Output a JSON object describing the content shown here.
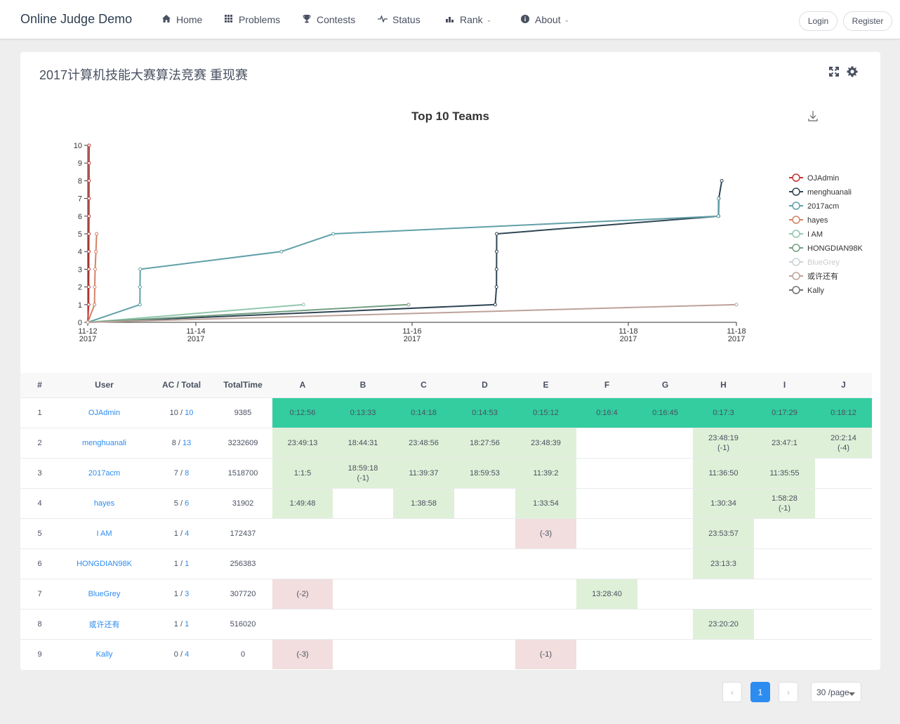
{
  "nav": {
    "brand": "Online Judge Demo",
    "items": [
      {
        "label": "Home",
        "icon": "home-icon"
      },
      {
        "label": "Problems",
        "icon": "grid-icon"
      },
      {
        "label": "Contests",
        "icon": "trophy-icon"
      },
      {
        "label": "Status",
        "icon": "pulse-icon"
      },
      {
        "label": "Rank",
        "icon": "bar-chart-icon"
      },
      {
        "label": "About",
        "icon": "info-icon"
      }
    ],
    "login": "Login",
    "register": "Register"
  },
  "contest": {
    "title": "2017计算机技能大赛算法竞赛 重现赛"
  },
  "chart_data": {
    "type": "line",
    "title": "Top 10 Teams",
    "xlabel": "",
    "ylabel": "",
    "ylim": [
      0,
      10
    ],
    "xlim": [
      "2017-11-12 00:00",
      "2017-11-18 00:00"
    ],
    "x_ticks": [
      {
        "t": "2017-11-12 00:00",
        "line1": "11-12",
        "line2": "2017"
      },
      {
        "t": "2017-11-13 00:00",
        "line1": "11-14",
        "line2": "2017"
      },
      {
        "t": "2017-11-15 00:00",
        "line1": "11-16",
        "line2": "2017"
      },
      {
        "t": "2017-11-17 00:00",
        "line1": "11-18",
        "line2": "2017"
      },
      {
        "t": "2017-11-18 00:00",
        "line1": "11-18",
        "line2": "2017"
      }
    ],
    "y_ticks": [
      0,
      1,
      2,
      3,
      4,
      5,
      6,
      7,
      8,
      9,
      10
    ],
    "grid": false,
    "legend": "right",
    "series": [
      {
        "name": "OJAdmin",
        "color": "#c23531",
        "points": [
          [
            "2017-11-12 00:00",
            0
          ],
          [
            "2017-11-12 00:12",
            1
          ],
          [
            "2017-11-12 00:13",
            2
          ],
          [
            "2017-11-12 00:14",
            3
          ],
          [
            "2017-11-12 00:14",
            4
          ],
          [
            "2017-11-12 00:15",
            5
          ],
          [
            "2017-11-12 00:16",
            6
          ],
          [
            "2017-11-12 00:16",
            7
          ],
          [
            "2017-11-12 00:17",
            8
          ],
          [
            "2017-11-12 00:17",
            9
          ],
          [
            "2017-11-12 00:18",
            10
          ]
        ]
      },
      {
        "name": "menghuanali",
        "color": "#2f4554",
        "points": [
          [
            "2017-11-12 00:00",
            0
          ],
          [
            "2017-11-15 18:27",
            1
          ],
          [
            "2017-11-15 18:44",
            2
          ],
          [
            "2017-11-15 18:45",
            3
          ],
          [
            "2017-11-15 18:46",
            4
          ],
          [
            "2017-11-15 18:47",
            5
          ],
          [
            "2017-11-17 20:02",
            6
          ],
          [
            "2017-11-17 20:05",
            7
          ],
          [
            "2017-11-17 20:45",
            8
          ]
        ]
      },
      {
        "name": "2017acm",
        "color": "#61a0a8",
        "points": [
          [
            "2017-11-12 00:00",
            0
          ],
          [
            "2017-11-12 11:35",
            1
          ],
          [
            "2017-11-12 11:36",
            2
          ],
          [
            "2017-11-12 11:39",
            3
          ],
          [
            "2017-11-13 18:59",
            4
          ],
          [
            "2017-11-14 06:30",
            5
          ],
          [
            "2017-11-17 19:59",
            6
          ],
          [
            "2017-11-17 20:01",
            7
          ]
        ]
      },
      {
        "name": "hayes",
        "color": "#d48265",
        "points": [
          [
            "2017-11-12 00:00",
            0
          ],
          [
            "2017-11-12 01:30",
            1
          ],
          [
            "2017-11-12 01:33",
            2
          ],
          [
            "2017-11-12 01:38",
            3
          ],
          [
            "2017-11-12 01:49",
            4
          ],
          [
            "2017-11-12 01:58",
            5
          ]
        ]
      },
      {
        "name": "I AM",
        "color": "#91c7ae",
        "points": [
          [
            "2017-11-12 00:00",
            0
          ],
          [
            "2017-11-13 23:53",
            1
          ]
        ]
      },
      {
        "name": "HONGDIAN98K",
        "color": "#749f83",
        "points": [
          [
            "2017-11-12 00:00",
            0
          ],
          [
            "2017-11-14 23:13",
            1
          ]
        ]
      },
      {
        "name": "BlueGrey",
        "color": "#ca8622",
        "points": []
      },
      {
        "name": "或许还有",
        "color": "#bda29a",
        "points": [
          [
            "2017-11-12 00:00",
            0
          ],
          [
            "2017-11-18 00:00",
            1
          ]
        ]
      },
      {
        "name": "Kally",
        "color": "#6e7074",
        "points": []
      }
    ],
    "legend_colors": [
      "#c23531",
      "#2f4554",
      "#61a0a8",
      "#d48265",
      "#91c7ae",
      "#749f83",
      "#c8d2d8",
      "#bda29a",
      "#6e7074"
    ]
  },
  "table": {
    "headers": [
      "#",
      "User",
      "AC / Total",
      "TotalTime",
      "A",
      "B",
      "C",
      "D",
      "E",
      "F",
      "G",
      "H",
      "I",
      "J"
    ],
    "rows": [
      {
        "rank": "1",
        "user": "OJAdmin",
        "ac": "10",
        "total": "10",
        "time": "9385",
        "cells": [
          [
            "fb",
            "0:12:56",
            ""
          ],
          [
            "fb",
            "0:13:33",
            ""
          ],
          [
            "fb",
            "0:14:18",
            ""
          ],
          [
            "fb",
            "0:14:53",
            ""
          ],
          [
            "fb",
            "0:15:12",
            ""
          ],
          [
            "fb",
            "0:16:4",
            ""
          ],
          [
            "fb",
            "0:16:45",
            ""
          ],
          [
            "fb",
            "0:17:3",
            ""
          ],
          [
            "fb",
            "0:17:29",
            ""
          ],
          [
            "fb",
            "0:18:12",
            ""
          ]
        ]
      },
      {
        "rank": "2",
        "user": "menghuanali",
        "ac": "8",
        "total": "13",
        "time": "3232609",
        "cells": [
          [
            "ac",
            "23:49:13",
            ""
          ],
          [
            "ac",
            "18:44:31",
            ""
          ],
          [
            "ac",
            "23:48:56",
            ""
          ],
          [
            "ac",
            "18:27:56",
            ""
          ],
          [
            "ac",
            "23:48:39",
            ""
          ],
          [
            "",
            "",
            ""
          ],
          [
            "",
            "",
            ""
          ],
          [
            "ac",
            "23:48:19",
            "(-1)"
          ],
          [
            "ac",
            "23:47:1",
            ""
          ],
          [
            "ac",
            "20:2:14",
            "(-4)"
          ]
        ]
      },
      {
        "rank": "3",
        "user": "2017acm",
        "ac": "7",
        "total": "8",
        "time": "1518700",
        "cells": [
          [
            "ac",
            "1:1:5",
            ""
          ],
          [
            "ac",
            "18:59:18",
            "(-1)"
          ],
          [
            "ac",
            "11:39:37",
            ""
          ],
          [
            "ac",
            "18:59:53",
            ""
          ],
          [
            "ac",
            "11:39:2",
            ""
          ],
          [
            "",
            "",
            ""
          ],
          [
            "",
            "",
            ""
          ],
          [
            "ac",
            "11:36:50",
            ""
          ],
          [
            "ac",
            "11:35:55",
            ""
          ],
          [
            "",
            "",
            ""
          ]
        ]
      },
      {
        "rank": "4",
        "user": "hayes",
        "ac": "5",
        "total": "6",
        "time": "31902",
        "cells": [
          [
            "ac",
            "1:49:48",
            ""
          ],
          [
            "",
            "",
            ""
          ],
          [
            "ac",
            "1:38:58",
            ""
          ],
          [
            "",
            "",
            ""
          ],
          [
            "ac",
            "1:33:54",
            ""
          ],
          [
            "",
            "",
            ""
          ],
          [
            "",
            "",
            ""
          ],
          [
            "ac",
            "1:30:34",
            ""
          ],
          [
            "ac",
            "1:58:28",
            "(-1)"
          ],
          [
            "",
            "",
            ""
          ]
        ]
      },
      {
        "rank": "5",
        "user": "I AM",
        "ac": "1",
        "total": "4",
        "time": "172437",
        "cells": [
          [
            "",
            "",
            ""
          ],
          [
            "",
            "",
            ""
          ],
          [
            "",
            "",
            ""
          ],
          [
            "",
            "",
            ""
          ],
          [
            "wa",
            "(-3)",
            ""
          ],
          [
            "",
            "",
            ""
          ],
          [
            "",
            "",
            ""
          ],
          [
            "ac",
            "23:53:57",
            ""
          ],
          [
            "",
            "",
            ""
          ],
          [
            "",
            "",
            ""
          ]
        ]
      },
      {
        "rank": "6",
        "user": "HONGDIAN98K",
        "ac": "1",
        "total": "1",
        "time": "256383",
        "cells": [
          [
            "",
            "",
            ""
          ],
          [
            "",
            "",
            ""
          ],
          [
            "",
            "",
            ""
          ],
          [
            "",
            "",
            ""
          ],
          [
            "",
            "",
            ""
          ],
          [
            "",
            "",
            ""
          ],
          [
            "",
            "",
            ""
          ],
          [
            "ac",
            "23:13:3",
            ""
          ],
          [
            "",
            "",
            ""
          ],
          [
            "",
            "",
            ""
          ]
        ]
      },
      {
        "rank": "7",
        "user": "BlueGrey",
        "ac": "1",
        "total": "3",
        "time": "307720",
        "cells": [
          [
            "wa",
            "(-2)",
            ""
          ],
          [
            "",
            "",
            ""
          ],
          [
            "",
            "",
            ""
          ],
          [
            "",
            "",
            ""
          ],
          [
            "",
            "",
            ""
          ],
          [
            "ac",
            "13:28:40",
            ""
          ],
          [
            "",
            "",
            ""
          ],
          [
            "",
            "",
            ""
          ],
          [
            "",
            "",
            ""
          ],
          [
            "",
            "",
            ""
          ]
        ]
      },
      {
        "rank": "8",
        "user": "或许还有",
        "ac": "1",
        "total": "1",
        "time": "516020",
        "cells": [
          [
            "",
            "",
            ""
          ],
          [
            "",
            "",
            ""
          ],
          [
            "",
            "",
            ""
          ],
          [
            "",
            "",
            ""
          ],
          [
            "",
            "",
            ""
          ],
          [
            "",
            "",
            ""
          ],
          [
            "",
            "",
            ""
          ],
          [
            "ac",
            "23:20:20",
            ""
          ],
          [
            "",
            "",
            ""
          ],
          [
            "",
            "",
            ""
          ]
        ]
      },
      {
        "rank": "9",
        "user": "Kally",
        "ac": "0",
        "total": "4",
        "time": "0",
        "cells": [
          [
            "wa",
            "(-3)",
            ""
          ],
          [
            "",
            "",
            ""
          ],
          [
            "",
            "",
            ""
          ],
          [
            "",
            "",
            ""
          ],
          [
            "wa",
            "(-1)",
            ""
          ],
          [
            "",
            "",
            ""
          ],
          [
            "",
            "",
            ""
          ],
          [
            "",
            "",
            ""
          ],
          [
            "",
            "",
            ""
          ],
          [
            "",
            "",
            ""
          ]
        ]
      }
    ]
  },
  "pagination": {
    "current_page": "1",
    "prev_icon": "chevron-left-icon",
    "next_icon": "chevron-right-icon",
    "page_size": "30 /page"
  }
}
